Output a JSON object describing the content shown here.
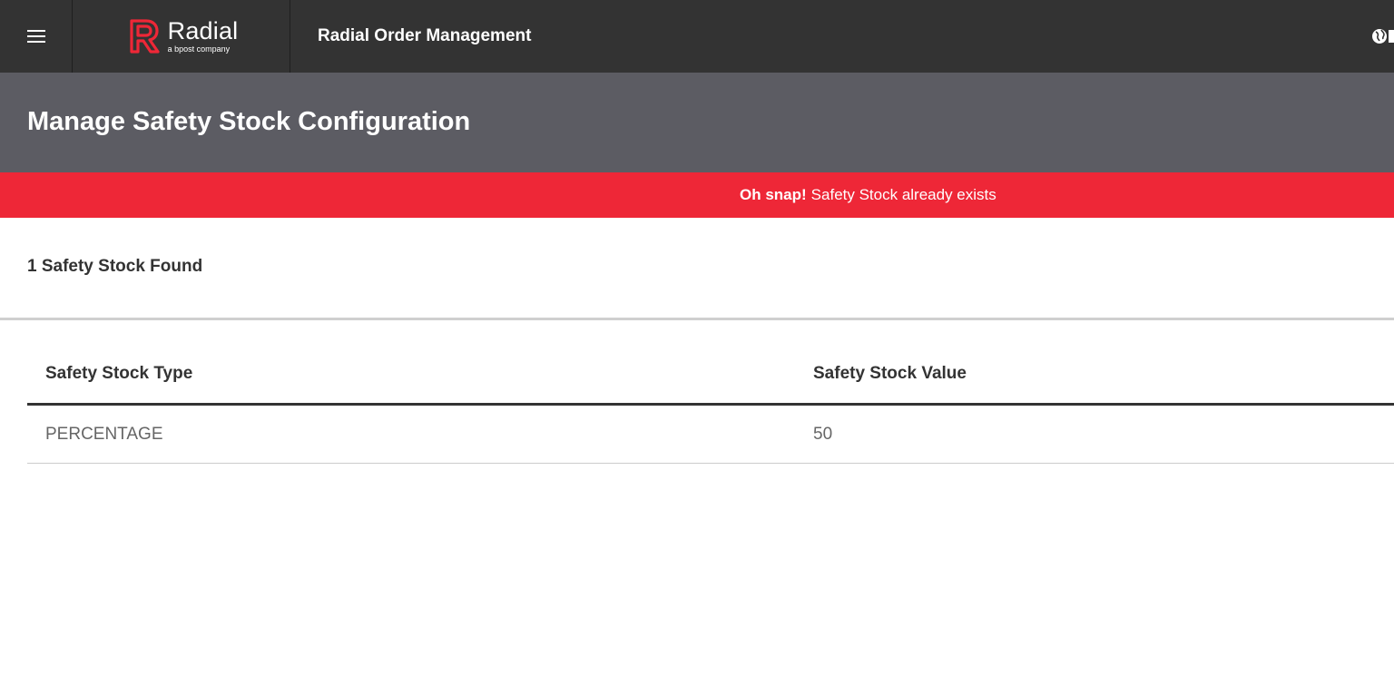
{
  "header": {
    "menu_icon": "hamburger-menu-icon",
    "logo_word": "Radial",
    "logo_sub": "a bpost company",
    "app_title": "Radial Order Management",
    "globe_icon": "globe-icon"
  },
  "page": {
    "title": "Manage Safety Stock Configuration"
  },
  "alert": {
    "strong": "Oh snap!",
    "message": "Safety Stock already exists"
  },
  "results": {
    "count_label": "1 Safety Stock Found"
  },
  "table": {
    "headers": [
      "Safety Stock Type",
      "Safety Stock Value"
    ],
    "rows": [
      [
        "PERCENTAGE",
        "50"
      ]
    ]
  },
  "colors": {
    "topbar": "#333333",
    "header_band": "#5c5c63",
    "alert": "#ee2737",
    "brand_red": "#ee2737"
  }
}
